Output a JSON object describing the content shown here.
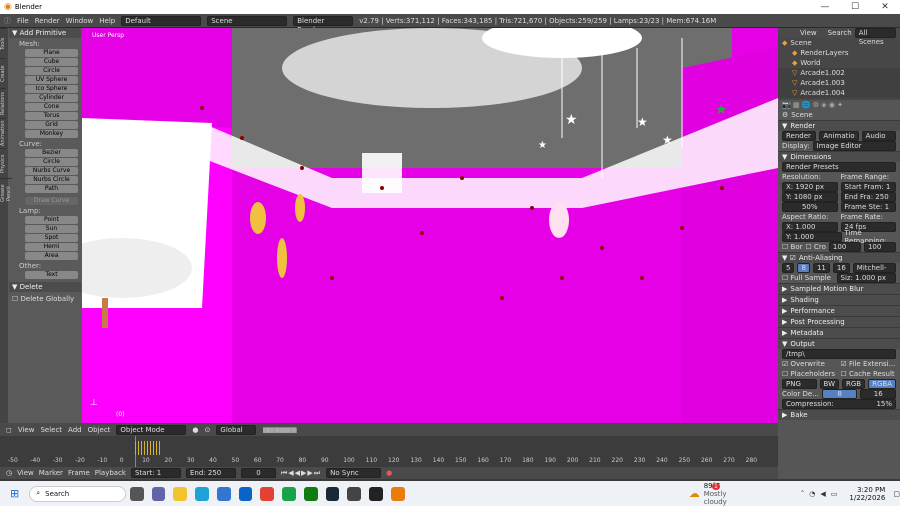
{
  "window": {
    "title": "Blender",
    "min": "—",
    "max": "☐",
    "close": "✕"
  },
  "menu": {
    "items": [
      "File",
      "Render",
      "Window",
      "Help"
    ],
    "layout": "Default",
    "scene": "Scene",
    "engine": "Blender Render",
    "stats": "v2.79 | Verts:371,112 | Faces:343,185 | Tris:721,670 | Objects:259/259 | Lamps:23/23 | Mem:674.16M"
  },
  "toolshelf": {
    "vertical_tabs": [
      "Tools",
      "Create",
      "Relations",
      "Animation",
      "Physics",
      "Grease Pencil"
    ],
    "panel_title": "Add Primitive",
    "groups": [
      {
        "label": "Mesh:",
        "buttons": [
          "Plane",
          "Cube",
          "Circle",
          "UV Sphere",
          "Ico Sphere",
          "Cylinder",
          "Cone",
          "Torus",
          "Grid",
          "Monkey"
        ]
      },
      {
        "label": "Curve:",
        "buttons": [
          "Bezier",
          "Circle",
          "Nurbs Curve",
          "Nurbs Circle",
          "Path"
        ]
      },
      {
        "label": "",
        "buttons": [
          "Draw Curve"
        ]
      },
      {
        "label": "Lamp:",
        "buttons": [
          "Point",
          "Sun",
          "Spot",
          "Hemi",
          "Area"
        ]
      },
      {
        "label": "Other:",
        "buttons": [
          "Text"
        ]
      }
    ],
    "delete_panel": "Delete",
    "delete_globally": "Delete Globally"
  },
  "viewport": {
    "label": "User Persp",
    "bg": "#e600e6",
    "counter": "(0)"
  },
  "view3d_header": {
    "items": [
      "View",
      "Select",
      "Add",
      "Object"
    ],
    "mode": "Object Mode",
    "orientation": "Global"
  },
  "timeline": {
    "ticks": [
      "-50",
      "-40",
      "-30",
      "-20",
      "-10",
      "0",
      "10",
      "20",
      "30",
      "40",
      "50",
      "60",
      "70",
      "80",
      "90",
      "100",
      "110",
      "120",
      "130",
      "140",
      "150",
      "160",
      "170",
      "180",
      "190",
      "200",
      "210",
      "220",
      "230",
      "240",
      "250",
      "260",
      "270",
      "280"
    ]
  },
  "timeline_header": {
    "items": [
      "View",
      "Marker",
      "Frame",
      "Playback"
    ],
    "start_label": "Start:",
    "start": "1",
    "end_label": "End:",
    "end": "250",
    "current": "0",
    "sync": "No Sync"
  },
  "outliner": {
    "tabs": [
      "View",
      "Search",
      "All Scenes"
    ],
    "items": [
      "Scene",
      "RenderLayers",
      "World",
      "Arcade1.002",
      "Arcade1.003",
      "Arcade1.004"
    ]
  },
  "properties": {
    "context": "Scene",
    "render_title": "Render",
    "render_buttons": [
      "Render",
      "Animatio",
      "Audio"
    ],
    "display_label": "Display:",
    "display_value": "Image Editor",
    "dimensions": "Dimensions",
    "presets": "Render Presets",
    "resolution": "Resolution:",
    "res_x": "X: 1920 px",
    "res_y": "Y: 1080 px",
    "res_pct": "50%",
    "frame_range": "Frame Range:",
    "start_frame": "Start Fram: 1",
    "end_frame": "End Fra: 250",
    "frame_step": "Frame Ste: 1",
    "aspect": "Aspect Ratio:",
    "asp_x": "X: 1.000",
    "asp_y": "Y: 1.000",
    "frame_rate": "Frame Rate:",
    "fps": "24 fps",
    "time_remap": "Time Remapping:",
    "remap_old": "100",
    "remap_new": "100",
    "bor": "Bor",
    "crop": "Cro",
    "aa": "Anti-Aliasing",
    "aa_samples": [
      "5",
      "8",
      "11",
      "16"
    ],
    "aa_filter": "Mitchell-Netr...",
    "full_sample": "Full Sample",
    "filter_size": "Siz: 1.000 px",
    "sections": [
      "Sampled Motion Blur",
      "Shading",
      "Performance",
      "Post Processing",
      "Metadata"
    ],
    "output": "Output",
    "output_path": "/tmp\\",
    "overwrite": "Overwrite",
    "file_ext": "File Extensi...",
    "placeholders": "Placeholders",
    "cache_result": "Cache Result",
    "format": "PNG",
    "color_modes": [
      "BW",
      "RGB",
      "RGBA"
    ],
    "color_depth": "Color De...",
    "depth_8": "8",
    "depth_16": "16",
    "compression": "Compression:",
    "compression_value": "15%",
    "bake": "Bake"
  },
  "taskbar": {
    "search": "Search",
    "weather_temp": "89°F",
    "weather_desc": "Mostly cloudy",
    "time": "3:20 PM",
    "date": "1/22/2026",
    "badge": "1"
  }
}
